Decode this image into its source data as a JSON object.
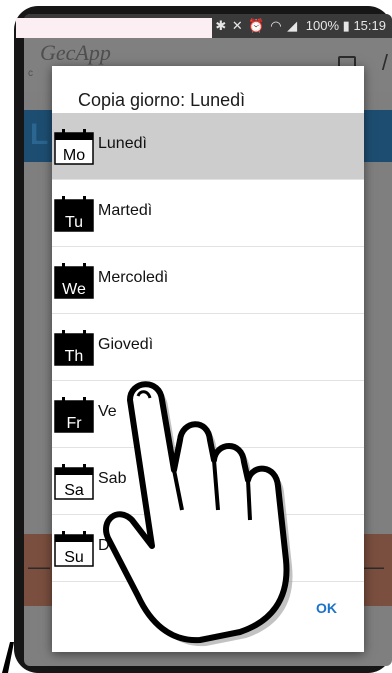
{
  "status_bar": {
    "time": "15:19",
    "battery": "100%",
    "left_icons": [
      "gallery-icon",
      "facebook-icon",
      "photo-icon",
      "clock-icon",
      "android-icon",
      "image-icon"
    ],
    "right_icons": [
      "bluetooth-icon",
      "mute-icon",
      "alarm-icon",
      "wifi-icon",
      "signal-icon",
      "battery-icon"
    ]
  },
  "app": {
    "logo": "GecApp",
    "subtitle": "c",
    "background_letter": "L"
  },
  "dialog": {
    "title": "Copia giorno: Lunedì",
    "days": [
      {
        "abbr": "Mo",
        "label": "Lunedì",
        "selected": true,
        "style": "outline"
      },
      {
        "abbr": "Tu",
        "label": "Martedì",
        "selected": false,
        "style": "filled"
      },
      {
        "abbr": "We",
        "label": "Mercoledì",
        "selected": false,
        "style": "filled"
      },
      {
        "abbr": "Th",
        "label": "Giovedì",
        "selected": false,
        "style": "filled"
      },
      {
        "abbr": "Fr",
        "label": "Ve",
        "selected": false,
        "style": "filled"
      },
      {
        "abbr": "Sa",
        "label": "Sab",
        "selected": false,
        "style": "outline"
      },
      {
        "abbr": "Su",
        "label": "Dom",
        "selected": false,
        "style": "outline"
      }
    ],
    "ok_label": "OK"
  },
  "colors": {
    "accent": "#1a73c9",
    "selected_row": "#cdcdcd",
    "dim_overlay": "#7f7f7f"
  }
}
